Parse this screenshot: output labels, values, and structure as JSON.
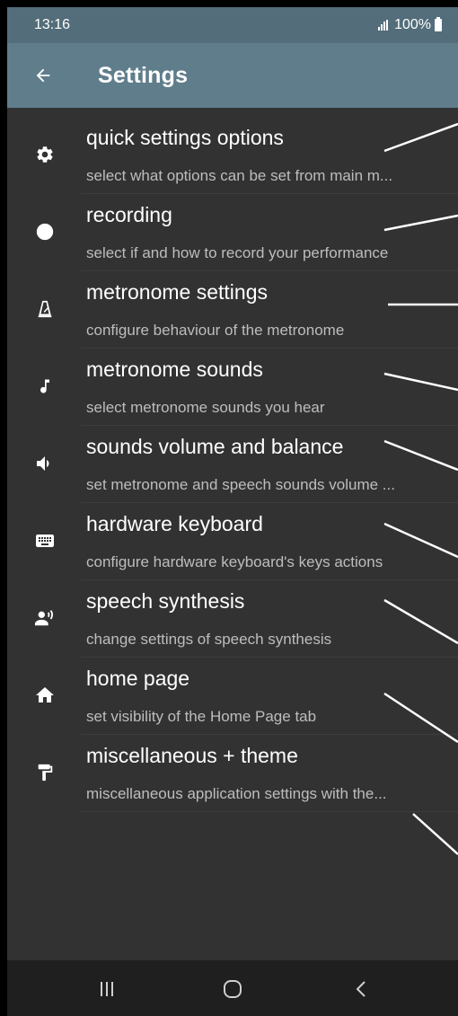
{
  "status_bar": {
    "time": "13:16",
    "battery": "100%"
  },
  "app_bar": {
    "title": "Settings",
    "back_icon": "arrow-back-icon"
  },
  "settings": [
    {
      "icon": "gear-icon",
      "title": "quick settings options",
      "subtitle": "select what options can be set from main m..."
    },
    {
      "icon": "record-dot-icon",
      "title": "recording",
      "subtitle": "select if and how to record your performance"
    },
    {
      "icon": "metronome-icon",
      "title": "metronome settings",
      "subtitle": "configure behaviour of the metronome"
    },
    {
      "icon": "music-note-icon",
      "title": "metronome sounds",
      "subtitle": "select metronome sounds you hear"
    },
    {
      "icon": "volume-icon",
      "title": "sounds volume and balance",
      "subtitle": "set metronome and speech sounds volume ..."
    },
    {
      "icon": "keyboard-icon",
      "title": "hardware keyboard",
      "subtitle": "configure hardware keyboard's keys actions"
    },
    {
      "icon": "speaking-person-icon",
      "title": "speech synthesis",
      "subtitle": "change settings of speech synthesis"
    },
    {
      "icon": "home-icon",
      "title": "home page",
      "subtitle": "set visibility of the Home Page tab"
    },
    {
      "icon": "paint-roller-icon",
      "title": "miscellaneous + theme",
      "subtitle": "miscellaneous application settings with the..."
    }
  ],
  "nav_bar": {
    "recent_icon": "recent-apps-icon",
    "home_icon": "home-button-icon",
    "back_icon": "back-chevron-icon"
  },
  "colors": {
    "status_bar": "#536d7a",
    "app_bar": "#607d8b",
    "background": "#323232",
    "nav_bar": "#1f1f1f",
    "title_text": "#ffffff",
    "subtitle_text": "#bdbdbd"
  }
}
